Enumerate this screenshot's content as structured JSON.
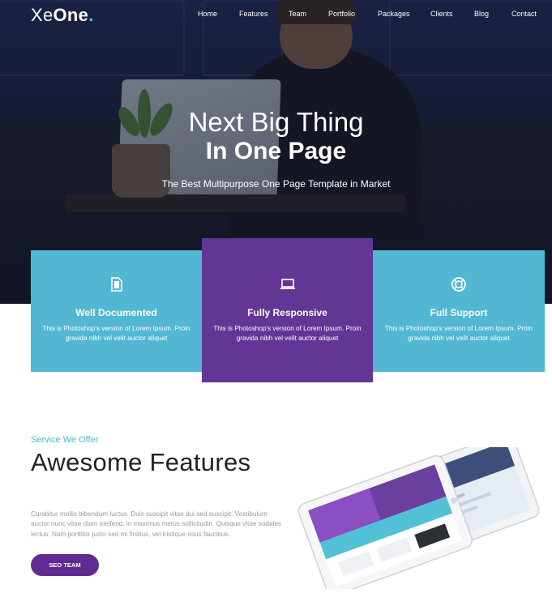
{
  "brand": {
    "light": "Xe",
    "bold": "One",
    "dot": "."
  },
  "nav": {
    "items": [
      "Home",
      "Features",
      "Team",
      "Portfolio",
      "Packages",
      "Clients",
      "Blog",
      "Contact"
    ]
  },
  "hero": {
    "line1": "Next Big Thing",
    "line2": "In One Page",
    "subtitle": "The Best Multipurpose One Page Template in Market"
  },
  "cards": [
    {
      "icon": "document-icon",
      "title": "Well Documented",
      "text": "This is Photoshop's version of Lorem Ipsum. Proin gravida nibh vel velit auctor aliquet"
    },
    {
      "icon": "laptop-icon",
      "title": "Fully Responsive",
      "text": "This is Photoshop's version of Lorem Ipsum. Proin gravida nibh vel velit auctor aliquet"
    },
    {
      "icon": "lifebuoy-icon",
      "title": "Full Support",
      "text": "This is Photoshop's version of Lorem Ipsum. Proin gravida nibh vel velit auctor aliquet"
    }
  ],
  "features": {
    "kicker": "Service We Offer",
    "heading": "Awesome Features",
    "paragraph": "Curabitur mollis bibendum luctus. Duis suscipit vitae dui sed suscipit. Vestibulum auctor nunc vitae diam eleifend, in maximus metus sollicitudin. Quisque vitae sodales lectus. Nam porttitor justo sed mi finibus, vel tristique risus faucibus.",
    "button": "SEO TEAM"
  },
  "colors": {
    "accent": "#51b7d3",
    "purple": "#633595",
    "button": "#5f2c91"
  }
}
